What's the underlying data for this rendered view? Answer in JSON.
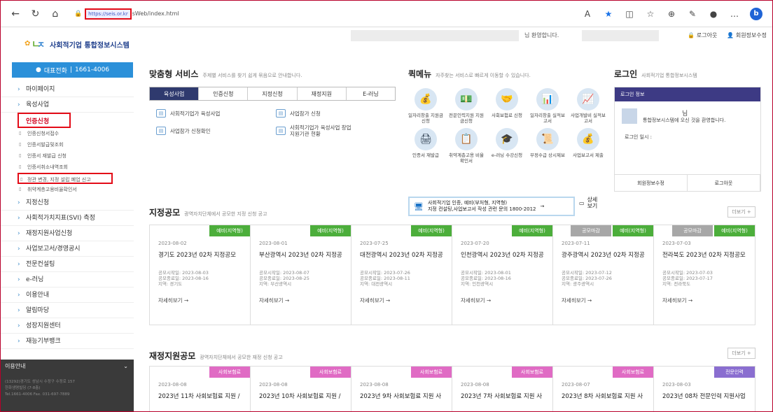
{
  "browser": {
    "url_host": "https://seis.or.kr",
    "url_path": "sWeb/index.html"
  },
  "header": {
    "logo_text": "사회적기업 통합정보시스템",
    "welcome": "님 환영합니다.",
    "logout": "로그아웃",
    "member_edit": "회원정보수정"
  },
  "sidebar": {
    "call_label": "대표전화",
    "call_number": "1661-4006",
    "items": [
      {
        "label": "마이페이지"
      },
      {
        "label": "육성사업"
      },
      {
        "label": "인증신청",
        "active": true
      }
    ],
    "subitems": [
      "인증신청서접수",
      "인증서발급및조회",
      "인증서 재발급 신청",
      "인증서취소내역조회",
      "정관 변경, 지정 설립 폐업 신고",
      "취약계층고용비율확인서"
    ],
    "items2": [
      "지정신청",
      "사회적가치지표(SVI) 측정",
      "재정지원사업신청",
      "사업보고서/경영공시",
      "전문컨설팅",
      "e-러닝",
      "이용안내",
      "알림마당",
      "성장지원센터",
      "재능기부뱅크"
    ],
    "info_title": "이용안내",
    "info_lines": [
      "(13292)경기도 성남시 수정구 수정로 157",
      "한화생명빌딩 (7-8층)",
      "Tel.1661-4006 Fax. 031-697-7889"
    ]
  },
  "service": {
    "title": "맞춤형 서비스",
    "desc": "주제별 서비스를 찾기 쉽게 묶음으로 안내합니다.",
    "tabs": [
      "육성사업",
      "인증신청",
      "지정신청",
      "재정지원",
      "E-러닝"
    ],
    "items": [
      "사회적기업가 육성사업",
      "사업참가 신청",
      "사업참가 신청확인",
      "사회적기업가 육성사업 창업지원기관 현황"
    ]
  },
  "quick": {
    "title": "퀵메뉴",
    "desc": "자주찾는 서비스로 빠르게 이동할 수 있습니다.",
    "items": [
      {
        "label": "일자리창출 지원금신청",
        "icon": "money-bag-icon",
        "glyph": "💰"
      },
      {
        "label": "전문인력지원 지원금신청",
        "icon": "cash-icon",
        "glyph": "💵"
      },
      {
        "label": "사회보험료 신청",
        "icon": "handshake-icon",
        "glyph": "🤝"
      },
      {
        "label": "일자리창출 실적보고서",
        "icon": "chart-doc-icon",
        "glyph": "📊"
      },
      {
        "label": "사업개발비 실적보고서",
        "icon": "report-icon",
        "glyph": "📈"
      },
      {
        "label": "인증서 재발급",
        "icon": "printer-icon",
        "glyph": "🖨"
      },
      {
        "label": "취약계층고용 비율확인서",
        "icon": "board-icon",
        "glyph": "📋"
      },
      {
        "label": "e-러닝 수강신청",
        "icon": "graduation-cap-icon",
        "glyph": "🎓"
      },
      {
        "label": "부정수급 상시제보",
        "icon": "certificate-icon",
        "glyph": "📜"
      },
      {
        "label": "사업보고서 제출",
        "icon": "money-sack-icon",
        "glyph": "💰"
      }
    ],
    "banner_line1": "사회적기업 인증, 예비(부처형, 지역형)",
    "banner_line2": "지정 컨설팅,사업보고서 작성 관련 문의 1800-2012",
    "banner_arrow": "→",
    "more_label": "상세 보기"
  },
  "login": {
    "title": "로그인",
    "desc": "사회적기업 통합정보시스템",
    "box_title": "로그인 정보",
    "name_suffix": "님",
    "message": "통합정보시스템에 오신 것을 환영합니다.",
    "date_label": "로그인 일시 :",
    "btn_edit": "회원정보수정",
    "btn_logout": "로그아웃"
  },
  "designation": {
    "title": "지정공모",
    "desc": "광역자치단체에서 공모한 지정 신청 공고",
    "more": "더보기 +",
    "cards": [
      {
        "badges": [
          {
            "t": "예비(지역형)",
            "c": "green"
          }
        ],
        "date": "2023-08-02",
        "title": "경기도 2023년 02차 지정공모",
        "start": "공모시작일: 2023-08-03",
        "end": "공모종료일: 2023-08-16",
        "region": "지역: 경기도"
      },
      {
        "badges": [
          {
            "t": "예비(지역형)",
            "c": "green"
          }
        ],
        "date": "2023-08-01",
        "title": "부산광역시 2023년 02차 지정공",
        "start": "공모시작일: 2023-08-07",
        "end": "공모종료일: 2023-08-25",
        "region": "지역: 부산광역시"
      },
      {
        "badges": [
          {
            "t": "예비(지역형)",
            "c": "green"
          }
        ],
        "date": "2023-07-25",
        "title": "대전광역시 2023년 02차 지정공",
        "start": "공모시작일: 2023-07-26",
        "end": "공모종료일: 2023-08-11",
        "region": "지역: 대전광역시"
      },
      {
        "badges": [
          {
            "t": "예비(지역형)",
            "c": "green"
          }
        ],
        "date": "2023-07-20",
        "title": "인천광역시 2023년 02차 지정공",
        "start": "공모시작일: 2023-08-01",
        "end": "공모종료일: 2023-08-16",
        "region": "지역: 인천광역시"
      },
      {
        "badges": [
          {
            "t": "공모마감",
            "c": "gray"
          },
          {
            "t": "예비(지역형)",
            "c": "green"
          }
        ],
        "date": "2023-07-11",
        "title": "광주광역시 2023년 02차 지정공",
        "start": "공모시작일: 2023-07-12",
        "end": "공모종료일: 2023-07-26",
        "region": "지역: 광주광역시"
      },
      {
        "badges": [
          {
            "t": "공모마감",
            "c": "gray"
          },
          {
            "t": "예비(지역형)",
            "c": "green"
          }
        ],
        "date": "2023-07-03",
        "title": "전라북도 2023년 02차 지정공모",
        "start": "공모시작일: 2023-07-03",
        "end": "공모종료일: 2023-07-17",
        "region": "지역: 전라북도"
      }
    ],
    "card_more": "자세히보기 →"
  },
  "finance": {
    "title": "재정지원공모",
    "desc": "광역자치단체에서 공모한 재정 신청 공고",
    "more": "더보기 +",
    "cards": [
      {
        "badge": "사회보험료",
        "c": "pink",
        "date": "2023-08-08",
        "title": "2023년 11차 사회보험료 지원 /"
      },
      {
        "badge": "사회보험료",
        "c": "pink",
        "date": "2023-08-08",
        "title": "2023년 10차 사회보험료 지원 /"
      },
      {
        "badge": "사회보험료",
        "c": "pink",
        "date": "2023-08-08",
        "title": "2023년 9차 사회보험료 지원 사"
      },
      {
        "badge": "사회보험료",
        "c": "pink",
        "date": "2023-08-08",
        "title": "2023년 7차 사회보험료 지원 사"
      },
      {
        "badge": "사회보험료",
        "c": "pink",
        "date": "2023-08-07",
        "title": "2023년 8차 사회보험료 지원 사"
      },
      {
        "badge": "전문인력",
        "c": "purple",
        "date": "2023-08-03",
        "title": "2023년 08차 전문인력 지원사업"
      }
    ]
  }
}
